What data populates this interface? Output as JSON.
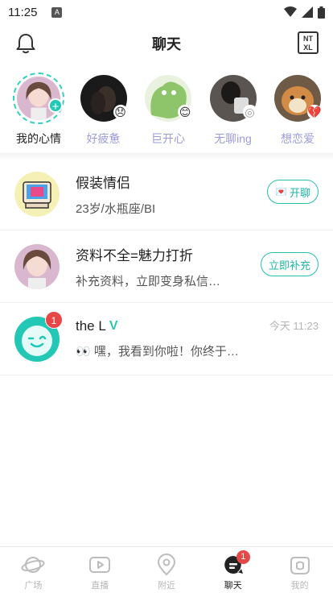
{
  "status_bar": {
    "time": "11:25",
    "notif_letter": "A"
  },
  "header": {
    "title": "聊天",
    "right_icon_text": "NT XL"
  },
  "stories": [
    {
      "label": "我的心情",
      "self": true,
      "badge": "+"
    },
    {
      "label": "好疲惫",
      "emoji": "😞"
    },
    {
      "label": "巨开心",
      "emoji": "😊"
    },
    {
      "label": "无聊ing",
      "emoji": "◎"
    },
    {
      "label": "想恋爱",
      "emoji": "💔"
    }
  ],
  "chats": [
    {
      "name": "假装情侣",
      "subtitle": "23岁/水瓶座/BI",
      "action_label": "开聊",
      "action_emoji": "💌"
    },
    {
      "name": "资料不全=魅力打折",
      "subtitle": "补充资料，立即变身私信…",
      "action_label": "立即补充"
    },
    {
      "name": "the L",
      "verified": "V",
      "subtitle": "👀 嘿，我看到你啦！你终于…",
      "time": "今天 11:23",
      "unread": "1"
    }
  ],
  "tabs": [
    {
      "label": "广场",
      "icon": "planet-icon"
    },
    {
      "label": "直播",
      "icon": "live-icon"
    },
    {
      "label": "附近",
      "icon": "location-icon"
    },
    {
      "label": "聊天",
      "icon": "chat-icon",
      "active": true,
      "badge": "1"
    },
    {
      "label": "我的",
      "icon": "profile-icon"
    }
  ],
  "colors": {
    "accent": "#22c7b6",
    "badge": "#e64848",
    "story_label": "#9b9dd8"
  }
}
